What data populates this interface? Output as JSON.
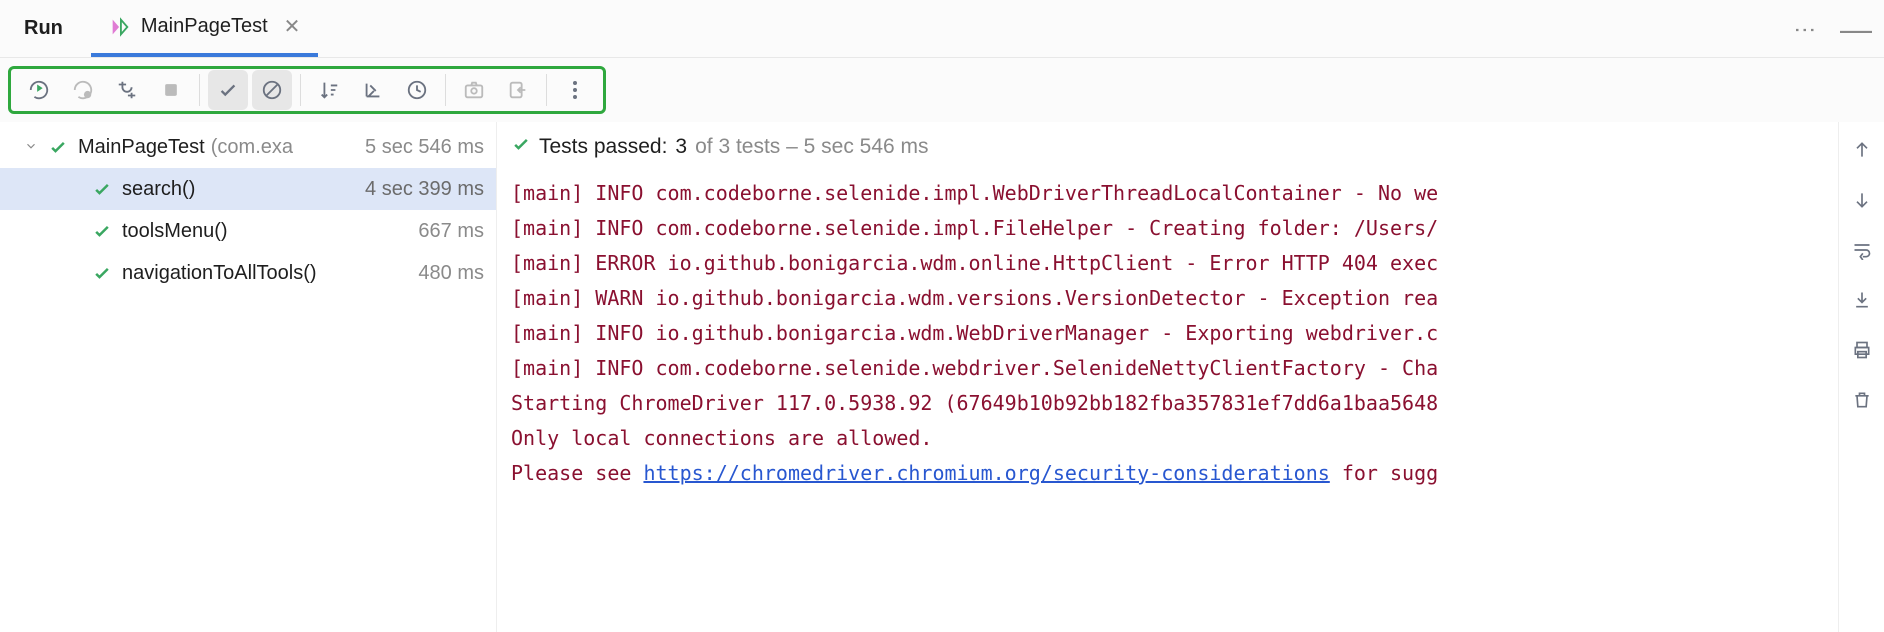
{
  "panel_title": "Run",
  "tab": {
    "label": "MainPageTest"
  },
  "summary": {
    "prefix": "Tests passed:",
    "passed": "3",
    "of_text": "of 3 tests – 5 sec 546 ms"
  },
  "tree": {
    "root": {
      "name": "MainPageTest",
      "qualifier": "(com.exa",
      "dur_sec": "5 sec",
      "dur_ms": "546 ms"
    },
    "children": [
      {
        "name": "search()",
        "dur_sec": "4 sec",
        "dur_ms": "399 ms"
      },
      {
        "name": "toolsMenu()",
        "dur_sec": "",
        "dur_ms": "667 ms"
      },
      {
        "name": "navigationToAllTools()",
        "dur_sec": "",
        "dur_ms": "480 ms"
      }
    ]
  },
  "log_lines": [
    "[main] INFO com.codeborne.selenide.impl.WebDriverThreadLocalContainer - No we",
    "[main] INFO com.codeborne.selenide.impl.FileHelper - Creating folder: /Users/",
    "[main] ERROR io.github.bonigarcia.wdm.online.HttpClient - Error HTTP 404 exec",
    "[main] WARN io.github.bonigarcia.wdm.versions.VersionDetector - Exception rea",
    "[main] INFO io.github.bonigarcia.wdm.WebDriverManager - Exporting webdriver.c",
    "[main] INFO com.codeborne.selenide.webdriver.SelenideNettyClientFactory - Cha",
    "Starting ChromeDriver 117.0.5938.92 (67649b10b92bb182fba357831ef7dd6a1baa5648",
    "Only local connections are allowed."
  ],
  "log_link_pre": "Please see ",
  "log_link_text": "https://chromedriver.chromium.org/security-considerations",
  "log_link_post": " for sugg"
}
